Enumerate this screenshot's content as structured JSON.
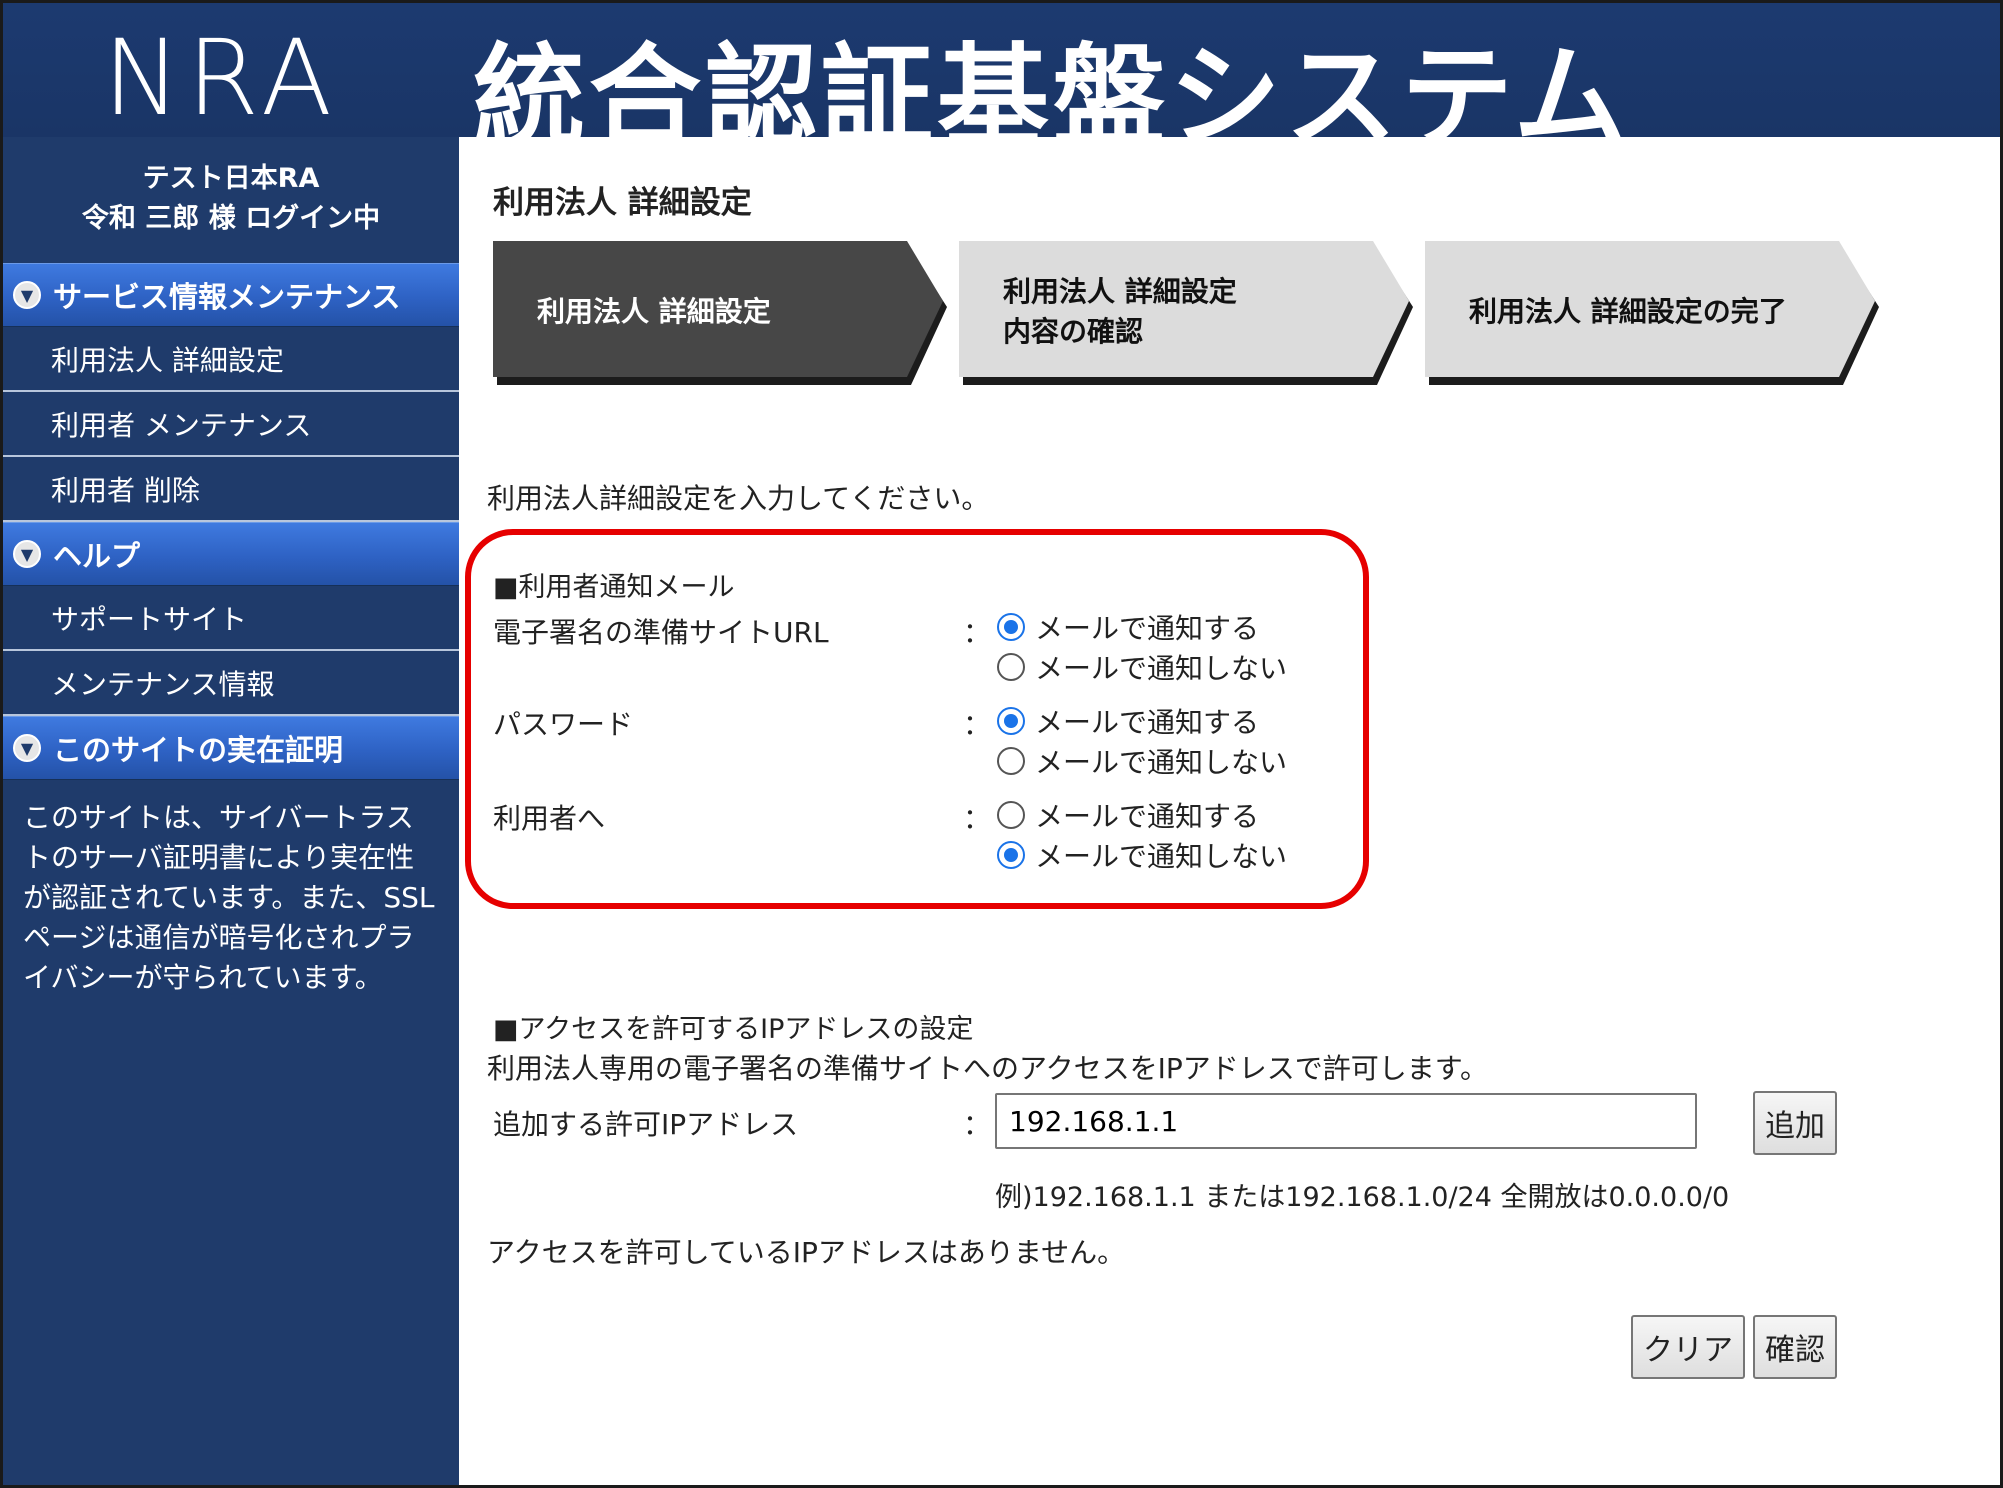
{
  "header": {
    "logo": "NRA",
    "title": "統合認証基盤システム"
  },
  "sidebar": {
    "user_line1": "テスト日本RA",
    "user_line2": "令和 三郎 様 ログイン中",
    "sections": [
      {
        "title": "サービス情報メンテナンス",
        "items": [
          "利用法人 詳細設定",
          "利用者 メンテナンス",
          "利用者 削除"
        ]
      },
      {
        "title": "ヘルプ",
        "items": [
          "サポートサイト",
          "メンテナンス情報"
        ]
      },
      {
        "title": "このサイトの実在証明"
      }
    ],
    "description": "このサイトは、サイバートラストのサーバ証明書により実在性が認証されています。また、SSLページは通信が暗号化されプライバシーが守られています。"
  },
  "main": {
    "page_title": "利用法人 詳細設定",
    "steps": [
      {
        "line1": "利用法人 詳細設定",
        "line2": ""
      },
      {
        "line1": "利用法人 詳細設定",
        "line2": "内容の確認"
      },
      {
        "line1": "利用法人 詳細設定の完了",
        "line2": ""
      }
    ],
    "intro": "利用法人詳細設定を入力してください。",
    "mail_section": "■利用者通知メール",
    "mail_rows": [
      {
        "label": "電子署名の準備サイトURL",
        "opt_yes": "メールで通知する",
        "opt_no": "メールで通知しない",
        "selected": "yes"
      },
      {
        "label": "パスワード",
        "opt_yes": "メールで通知する",
        "opt_no": "メールで通知しない",
        "selected": "yes"
      },
      {
        "label": "利用者へ",
        "opt_yes": "メールで通知する",
        "opt_no": "メールで通知しない",
        "selected": "no"
      }
    ],
    "colon": "：",
    "ip_section": "■アクセスを許可するIPアドレスの設定",
    "ip_desc": "利用法人専用の電子署名の準備サイトへのアクセスをIPアドレスで許可します。",
    "ip_label": "追加する許可IPアドレス",
    "ip_value": "192.168.1.1",
    "add_button": "追加",
    "ip_example": "例)192.168.1.1 または192.168.1.0/24 全開放は0.0.0.0/0",
    "ip_none": "アクセスを許可しているIPアドレスはありません。",
    "clear_button": "クリア",
    "confirm_button": "確認"
  },
  "colors": {
    "header_bg": "#1c3a70",
    "sidebar_bg": "#1f3b6b",
    "section_head": "#2e62c4",
    "highlight": "#e60000",
    "active_step": "#474747",
    "inactive_step": "#dcdcdc"
  }
}
